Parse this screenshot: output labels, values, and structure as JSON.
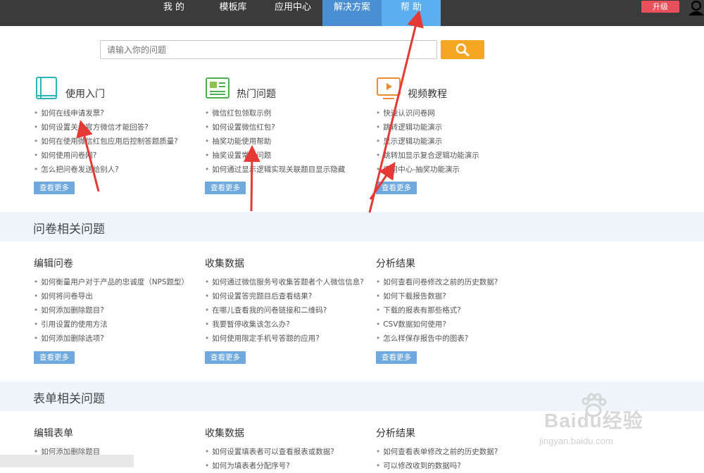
{
  "nav": {
    "items": [
      {
        "label": "我 的"
      },
      {
        "label": "模板库"
      },
      {
        "label": "应用中心"
      },
      {
        "label": "解决方案"
      },
      {
        "label": "帮 助"
      }
    ],
    "upgrade_label": "升级"
  },
  "search": {
    "placeholder": "请输入你的问题"
  },
  "top": {
    "cols": [
      {
        "title": "使用入门",
        "items": [
          "如何在线申请发票?",
          "如何设置关注官方微信才能回答?",
          "如何在使用微信红包应用后控制答题质量?",
          "如何使用问卷网?",
          "怎么把问卷发送给别人?"
        ],
        "more": "查看更多"
      },
      {
        "title": "热门问题",
        "items": [
          "微信红包领取示例",
          "如何设置微信红包?",
          "抽奖功能使用帮助",
          "抽奖设置常见问题",
          "如何通过显示逻辑实现关联题目显示隐藏"
        ],
        "more": "查看更多"
      },
      {
        "title": "视频教程",
        "items": [
          "快速认识问卷网",
          "跳转逻辑功能演示",
          "显示逻辑功能演示",
          "跳转加显示复合逻辑功能演示",
          "应用中心-抽奖功能演示"
        ],
        "more": "查看更多"
      }
    ]
  },
  "survey": {
    "band_title": "问卷相关问题",
    "cols": [
      {
        "title": "编辑问卷",
        "items": [
          "如何衡量用户对于产品的忠诚度（NPS题型）",
          "如何将问卷导出",
          "如何添加删除题目?",
          "引用设置的使用方法",
          "如何添加删除选项?"
        ],
        "more": "查看更多"
      },
      {
        "title": "收集数据",
        "items": [
          "如何通过微信服务号收集答题者个人微信信息?",
          "如何设置答完题目后查看结果?",
          "在哪儿查看我的问卷链接和二维码?",
          "我要暂停收集该怎么办?",
          "如何使用限定手机号答题的应用?"
        ],
        "more": "查看更多"
      },
      {
        "title": "分析结果",
        "items": [
          "如何查看问卷修改之前的历史数据?",
          "如何下载报告数据?",
          "下载的报表有那些格式?",
          "CSV数据如何使用?",
          "怎么样保存报告中的图表?"
        ],
        "more": "查看更多"
      }
    ]
  },
  "form": {
    "band_title": "表单相关问题",
    "cols": [
      {
        "title": "编辑表单",
        "items": [
          "如何添加删除题目"
        ]
      },
      {
        "title": "收集数据",
        "items": [
          "如何设置填表者可以查看报表或数据?",
          "如何为填表者分配序号?"
        ]
      },
      {
        "title": "分析结果",
        "items": [
          "如何查看表单修改之前的历史数据?",
          "可以修改收到的数据吗?"
        ]
      }
    ]
  },
  "watermark": {
    "logo": "Baidu经验",
    "url": "jingyan.baidu.com"
  },
  "colors": {
    "topbar": "#3b3b3b",
    "solutions": "#4a8fd2",
    "help": "#5baef0",
    "upgrade": "#e8505b",
    "search_button": "#f5a623",
    "more_button": "#6fa9dd",
    "band": "#eef5fb",
    "annotation_arrow": "#e53935"
  }
}
